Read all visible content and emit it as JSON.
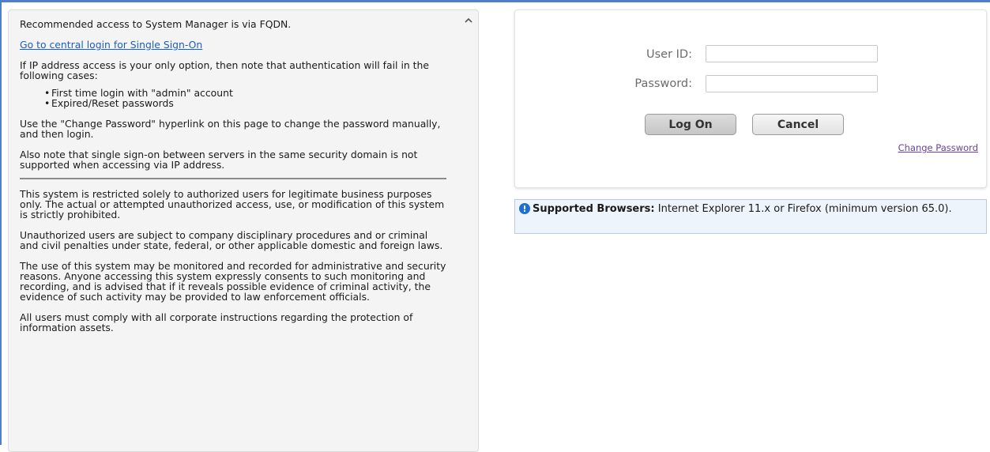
{
  "notice": {
    "p1": "Recommended access to System Manager is via FQDN.",
    "sso_link": "Go to central login for Single Sign-On",
    "p2": "If IP address access is your only option, then note that authentication will fail in the following cases:",
    "bullets": [
      "First time login with \"admin\" account",
      "Expired/Reset passwords"
    ],
    "p3": "Use the \"Change Password\" hyperlink on this page to change the password manually, and then login.",
    "p4": "Also note that single sign-on between servers in the same security domain is not supported when accessing via IP address.",
    "p5": "This system is restricted solely to authorized users for legitimate business purposes only. The actual or attempted unauthorized access, use, or modification of this system is strictly prohibited.",
    "p6": "Unauthorized users are subject to company disciplinary procedures and or criminal and civil penalties under state, federal, or other applicable domestic and foreign laws.",
    "p7": "The use of this system may be monitored and recorded for administrative and security reasons. Anyone accessing this system expressly consents to such monitoring and recording, and is advised that if it reveals possible evidence of criminal activity, the evidence of such activity may be provided to law enforcement officials.",
    "p8": "All users must comply with all corporate instructions regarding the protection of information assets."
  },
  "login": {
    "user_label": "User ID:",
    "password_label": "Password:",
    "user_value": "",
    "password_value": "",
    "logon_label": "Log On",
    "cancel_label": "Cancel",
    "change_password": "Change Password"
  },
  "browsers": {
    "bold": "Supported Browsers:",
    "text": " Internet Explorer 11.x or Firefox (minimum version 65.0)."
  },
  "icons": {
    "scroll_up": "chevron-up-icon",
    "info": "info-icon"
  },
  "colors": {
    "link": "#1a5fbf",
    "change_password_link": "#6a3fa0",
    "info_blue": "#1f6fd1",
    "frame_blue": "#4f7fc6"
  }
}
